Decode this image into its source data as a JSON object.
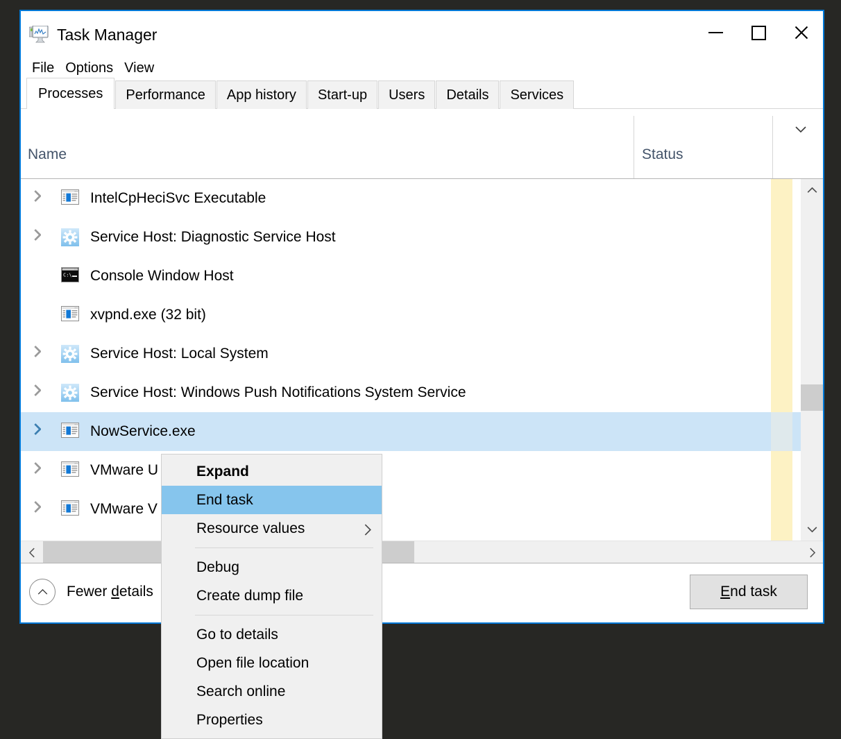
{
  "window": {
    "title": "Task Manager",
    "icon": "task-manager-icon",
    "border_color": "#0078d7",
    "controls": [
      {
        "name": "minimize-button",
        "glyph": "minimize-icon"
      },
      {
        "name": "maximize-button",
        "glyph": "maximize-icon"
      },
      {
        "name": "close-button",
        "glyph": "close-icon"
      }
    ]
  },
  "menubar": {
    "items": [
      {
        "label": "File"
      },
      {
        "label": "Options"
      },
      {
        "label": "View"
      }
    ]
  },
  "tabs": {
    "active": "Processes",
    "items": [
      {
        "label": "Processes",
        "active": true
      },
      {
        "label": "Performance",
        "active": false
      },
      {
        "label": "App history",
        "active": false
      },
      {
        "label": "Start-up",
        "active": false
      },
      {
        "label": "Users",
        "active": false
      },
      {
        "label": "Details",
        "active": false
      },
      {
        "label": "Services",
        "active": false
      }
    ]
  },
  "columns": {
    "name_header": "Name",
    "status_header": "Status",
    "header_color": "#44546a",
    "expand_chevron": "chevron-down-icon"
  },
  "process_list": {
    "rows": [
      {
        "name": "IntelCpHeciSvc Executable",
        "icon": "app-window-icon",
        "expandable": true,
        "selected": false
      },
      {
        "name": "Service Host: Diagnostic Service Host",
        "icon": "gear-icon",
        "expandable": true,
        "selected": false
      },
      {
        "name": "Console Window Host",
        "icon": "console-icon",
        "expandable": false,
        "selected": false
      },
      {
        "name": "xvpnd.exe (32 bit)",
        "icon": "app-window-icon",
        "expandable": false,
        "selected": false
      },
      {
        "name": "Service Host: Local System",
        "icon": "gear-icon",
        "expandable": true,
        "selected": false
      },
      {
        "name": "Service Host: Windows Push Notifications System Service",
        "icon": "gear-icon",
        "expandable": true,
        "selected": false
      },
      {
        "name": "NowService.exe",
        "icon": "app-window-icon",
        "expandable": true,
        "selected": true
      },
      {
        "name": "VMware U",
        "icon": "app-window-icon",
        "expandable": true,
        "selected": false
      },
      {
        "name": "VMware V",
        "icon": "app-window-icon",
        "expandable": true,
        "selected": false
      }
    ],
    "selection_color": "#cce4f7",
    "heat_column_color": "#fdf2c4"
  },
  "scrollbars": {
    "vertical": {
      "up": "chevron-up-icon",
      "down": "chevron-down-icon",
      "thumb": "scroll-thumb"
    },
    "horizontal": {
      "left": "chevron-left-icon",
      "right": "chevron-right-icon",
      "thumb": "scroll-thumb"
    }
  },
  "statusbar": {
    "fewer_details": {
      "prefix": "Fewer ",
      "accel": "d",
      "suffix": "etails"
    },
    "fewer_icon": "chevron-up-circle-icon",
    "end_task": {
      "accel": "E",
      "suffix": "nd task"
    }
  },
  "context_menu": {
    "items": [
      {
        "label": "Expand",
        "bold": true,
        "highlight": false,
        "submenu": false
      },
      {
        "label": "End task",
        "bold": false,
        "highlight": true,
        "submenu": false
      },
      {
        "label": "Resource values",
        "bold": false,
        "highlight": false,
        "submenu": true
      },
      {
        "separator": true
      },
      {
        "label": "Debug",
        "bold": false,
        "highlight": false,
        "submenu": false
      },
      {
        "label": "Create dump file",
        "bold": false,
        "highlight": false,
        "submenu": false
      },
      {
        "separator": true
      },
      {
        "label": "Go to details",
        "bold": false,
        "highlight": false,
        "submenu": false
      },
      {
        "label": "Open file location",
        "bold": false,
        "highlight": false,
        "submenu": false
      },
      {
        "label": "Search online",
        "bold": false,
        "highlight": false,
        "submenu": false
      },
      {
        "label": "Properties",
        "bold": false,
        "highlight": false,
        "submenu": false
      }
    ],
    "highlight_color": "#86c5ed"
  }
}
